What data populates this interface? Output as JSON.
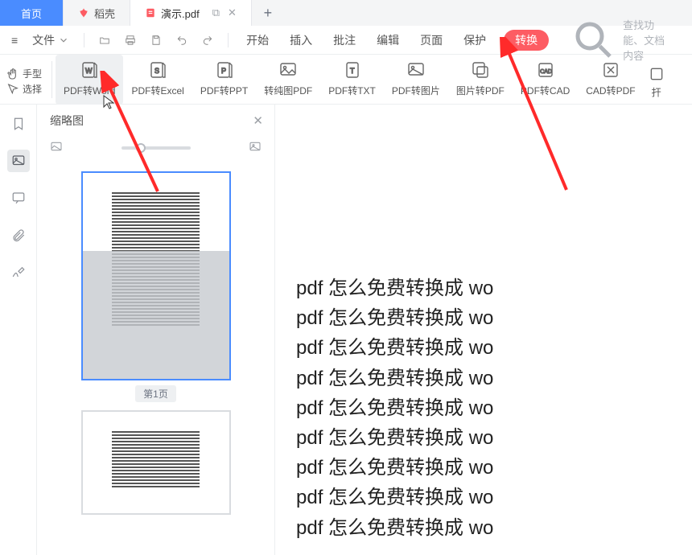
{
  "tabs": {
    "home": "首页",
    "items": [
      {
        "label": "稻壳"
      },
      {
        "label": "演示.pdf",
        "active": true
      }
    ],
    "window_controls": {
      "restore": "⧉",
      "close": "✕"
    },
    "add": "+"
  },
  "menubar": {
    "hamburger": "≡",
    "file": "文件",
    "items": [
      "开始",
      "插入",
      "批注",
      "编辑",
      "页面",
      "保护"
    ],
    "highlight": "转换",
    "search_placeholder": "查找功能、文档内容"
  },
  "ribbon": {
    "hand": "手型",
    "select": "选择",
    "buttons": [
      {
        "id": "pdf2word",
        "label": "PDF转Word",
        "hover": true,
        "icon": "word"
      },
      {
        "id": "pdf2excel",
        "label": "PDF转Excel",
        "icon": "excel"
      },
      {
        "id": "pdf2ppt",
        "label": "PDF转PPT",
        "icon": "ppt"
      },
      {
        "id": "pureimgpdf",
        "label": "转纯图PDF",
        "icon": "image"
      },
      {
        "id": "pdf2txt",
        "label": "PDF转TXT",
        "icon": "txt"
      },
      {
        "id": "pdf2img",
        "label": "PDF转图片",
        "icon": "pic"
      },
      {
        "id": "img2pdf",
        "label": "图片转PDF",
        "icon": "pic2"
      },
      {
        "id": "pdf2cad",
        "label": "PDF转CAD",
        "icon": "cad"
      },
      {
        "id": "cad2pdf",
        "label": "CAD转PDF",
        "icon": "cad2"
      }
    ],
    "more": "扞"
  },
  "sidebar": {
    "items": [
      {
        "id": "bookmark",
        "icon": "bookmark"
      },
      {
        "id": "thumbnails",
        "icon": "image",
        "active": true
      },
      {
        "id": "comment",
        "icon": "comment"
      },
      {
        "id": "attach",
        "icon": "attach"
      },
      {
        "id": "sign",
        "icon": "sign"
      }
    ]
  },
  "thumb_panel": {
    "title": "缩略图",
    "page_label": "第1页"
  },
  "document_lines": [
    "pdf 怎么免费转换成 wo",
    "pdf 怎么免费转换成 wo",
    "pdf 怎么免费转换成 wo",
    "pdf 怎么免费转换成 wo",
    "pdf 怎么免费转换成 wo",
    "pdf 怎么免费转换成 wo",
    "pdf 怎么免费转换成 wo",
    "pdf 怎么免费转换成 wo",
    "pdf 怎么免费转换成 wo"
  ]
}
